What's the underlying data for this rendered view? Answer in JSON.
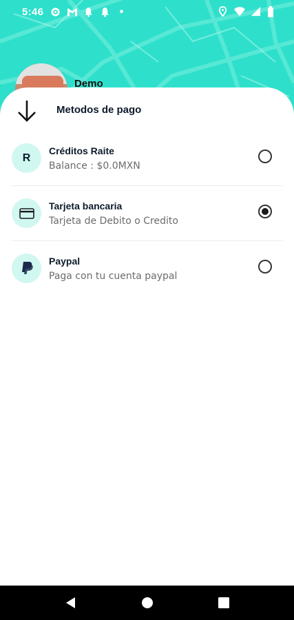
{
  "status_bar": {
    "time": "5:46",
    "left_icons": [
      "settings-icon",
      "gmail-icon",
      "notification-bell-icon",
      "notification-bell-icon",
      "dot-icon"
    ],
    "right_icons": [
      "location-icon",
      "wifi-icon",
      "signal-icon",
      "battery-icon"
    ]
  },
  "profile": {
    "name": "Demo"
  },
  "sheet": {
    "title": "Metodos de pago",
    "back_icon": "arrow-down-icon",
    "methods": [
      {
        "icon": "R",
        "icon_name": "raite-credits-icon",
        "title": "Créditos Raite",
        "subtitle": "Balance : $0.0MXN",
        "selected": false
      },
      {
        "icon": "card",
        "icon_name": "credit-card-icon",
        "title": "Tarjeta bancaria",
        "subtitle": "Tarjeta de Debito o Credito",
        "selected": true
      },
      {
        "icon": "paypal",
        "icon_name": "paypal-icon",
        "title": "Paypal",
        "subtitle": "Paga con tu cuenta paypal",
        "selected": false
      }
    ]
  },
  "nav_bar": {
    "buttons": [
      "back-icon",
      "home-icon",
      "recents-icon"
    ]
  },
  "colors": {
    "accent": "#2ee0cb",
    "icon_bg": "#d1f7f1",
    "text_dark": "#0d1b2a",
    "text_muted": "#6b6b6b"
  }
}
